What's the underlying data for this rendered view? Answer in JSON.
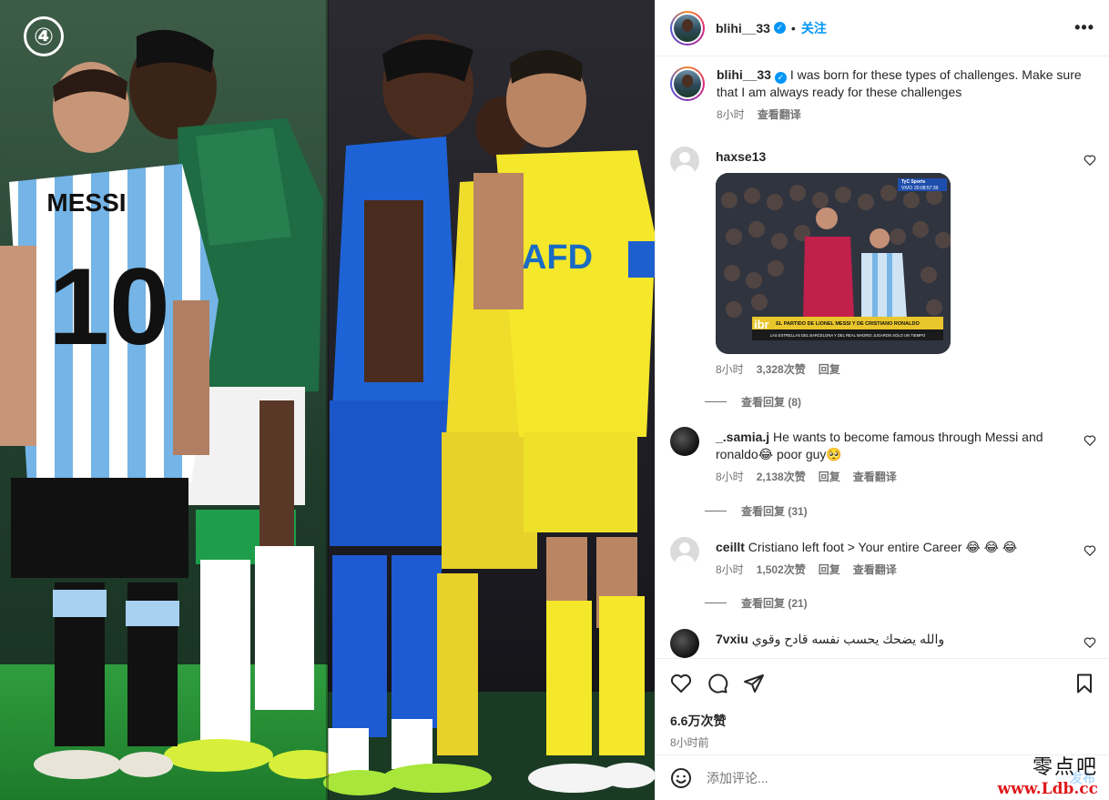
{
  "media": {
    "slide_number": "④",
    "left_photo": {
      "jersey_name": "MESSI",
      "jersey_number": "10"
    },
    "right_photo": {
      "shirt_text": "AFD"
    }
  },
  "post": {
    "author": "blihi__33",
    "follow_label": "关注",
    "more_label": "•••",
    "caption": {
      "username": "blihi__33",
      "text": "I was born for these types of challenges. Make sure that I am always ready for these challenges",
      "time": "8小时",
      "translate_label": "查看翻译"
    }
  },
  "comments": [
    {
      "username": "haxse13",
      "text": "",
      "time": "8小时",
      "likes": "3,328次赞",
      "reply_label": "回复",
      "translate_label": "",
      "view_replies": "查看回复 (8)",
      "gif": {
        "caption": "EL PARTIDO DE LIONEL MESSI Y DE CRISTIANO RONALDO",
        "subcaption": "LAS ESTRELLAS DEL BARCELONA Y DEL REAL MADRID JUGARON SOLO UN TIEMPO",
        "channel": "TyC Sports",
        "live": "VIVO",
        "clock": "20:08:57:39",
        "corner": "ibr"
      }
    },
    {
      "username": "_.samia.j",
      "text": "He wants to become famous through Messi and ronaldo😂 poor guy🥺",
      "time": "8小时",
      "likes": "2,138次赞",
      "reply_label": "回复",
      "translate_label": "查看翻译",
      "view_replies": "查看回复 (31)"
    },
    {
      "username": "ceillt",
      "text": "Cristiano left foot > Your entire Career 😂 😂 😂",
      "time": "8小时",
      "likes": "1,502次赞",
      "reply_label": "回复",
      "translate_label": "查看翻译",
      "view_replies": "查看回复 (21)"
    },
    {
      "username": "7vxiu",
      "text": "والله يضحك يحسب نفسه قادح وقوي"
    }
  ],
  "footer": {
    "likes": "6.6万次赞",
    "time": "8小时前",
    "comment_placeholder": "添加评论...",
    "post_label": "发布"
  },
  "watermark": {
    "cn": "零点吧",
    "url": "www.Ldb.cc"
  },
  "colors": {
    "link": "#0095f6",
    "muted": "#737373",
    "text": "#262626"
  },
  "icons": [
    "verified-icon",
    "heart-icon",
    "comment-icon",
    "share-icon",
    "bookmark-icon",
    "emoji-icon",
    "more-icon"
  ]
}
